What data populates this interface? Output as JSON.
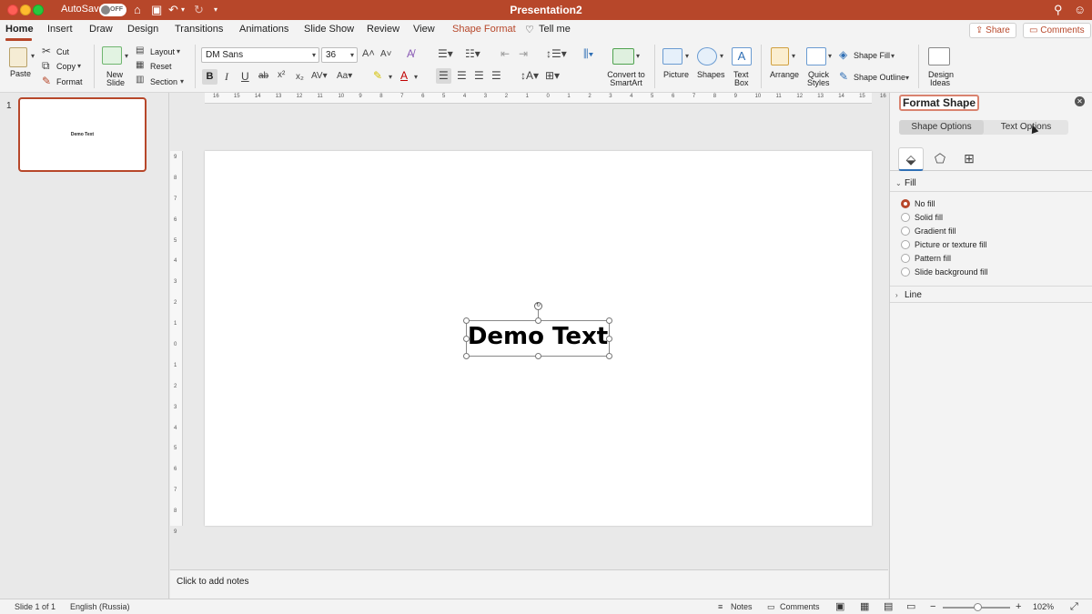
{
  "titlebar": {
    "autosave_label": "AutoSave",
    "autosave_state": "OFF",
    "document_title": "Presentation2"
  },
  "tabs": [
    {
      "label": "Home",
      "active": true
    },
    {
      "label": "Insert"
    },
    {
      "label": "Draw"
    },
    {
      "label": "Design"
    },
    {
      "label": "Transitions"
    },
    {
      "label": "Animations"
    },
    {
      "label": "Slide Show"
    },
    {
      "label": "Review"
    },
    {
      "label": "View"
    },
    {
      "label": "Shape Format",
      "contextual": true
    },
    {
      "label": "Tell me"
    }
  ],
  "top_buttons": {
    "share": "Share",
    "comments": "Comments"
  },
  "ribbon": {
    "paste": "Paste",
    "cut": "Cut",
    "copy": "Copy",
    "format": "Format",
    "new_slide_1": "New",
    "new_slide_2": "Slide",
    "layout": "Layout",
    "reset": "Reset",
    "section": "Section",
    "font_name": "DM Sans",
    "font_size": "36",
    "bold": "B",
    "italic": "I",
    "underline": "U",
    "convert_smartart_1": "Convert to",
    "convert_smartart_2": "SmartArt",
    "picture": "Picture",
    "shapes": "Shapes",
    "text_box_1": "Text",
    "text_box_2": "Box",
    "arrange": "Arrange",
    "quick_styles_1": "Quick",
    "quick_styles_2": "Styles",
    "shape_fill": "Shape Fill",
    "shape_outline": "Shape Outline",
    "design_ideas_1": "Design",
    "design_ideas_2": "Ideas"
  },
  "thumbnails": [
    {
      "number": "1",
      "text": "Demo Text"
    }
  ],
  "slide": {
    "text": "Demo Text"
  },
  "ruler_labels": {
    "top": [
      "16",
      "15",
      "14",
      "13",
      "12",
      "11",
      "10",
      "9",
      "8",
      "7",
      "6",
      "5",
      "4",
      "3",
      "2",
      "1",
      "0",
      "1",
      "2",
      "3",
      "4",
      "5",
      "6",
      "7",
      "8",
      "9",
      "10",
      "11",
      "12",
      "13",
      "14",
      "15",
      "16"
    ],
    "left": [
      "9",
      "8",
      "7",
      "6",
      "5",
      "4",
      "3",
      "2",
      "1",
      "0",
      "1",
      "2",
      "3",
      "4",
      "5",
      "6",
      "7",
      "8",
      "9"
    ]
  },
  "notes": {
    "placeholder": "Click to add notes"
  },
  "format_pane": {
    "title": "Format Shape",
    "tab_shape_options": "Shape Options",
    "tab_text_options": "Text Options",
    "section_fill": "Fill",
    "fill_options": [
      {
        "label": "No fill",
        "selected": true
      },
      {
        "label": "Solid fill",
        "selected": false
      },
      {
        "label": "Gradient fill",
        "selected": false
      },
      {
        "label": "Picture or texture fill",
        "selected": false
      },
      {
        "label": "Pattern fill",
        "selected": false
      },
      {
        "label": "Slide background fill",
        "selected": false
      }
    ],
    "section_line": "Line"
  },
  "status": {
    "slide_counter": "Slide 1 of 1",
    "language": "English (Russia)",
    "notes": "Notes",
    "comments": "Comments",
    "zoom_minus": "−",
    "zoom_plus": "+",
    "zoom_level": "102%"
  },
  "colors": {
    "accent": "#b7472a",
    "window_bg": "#e9e9e9"
  }
}
